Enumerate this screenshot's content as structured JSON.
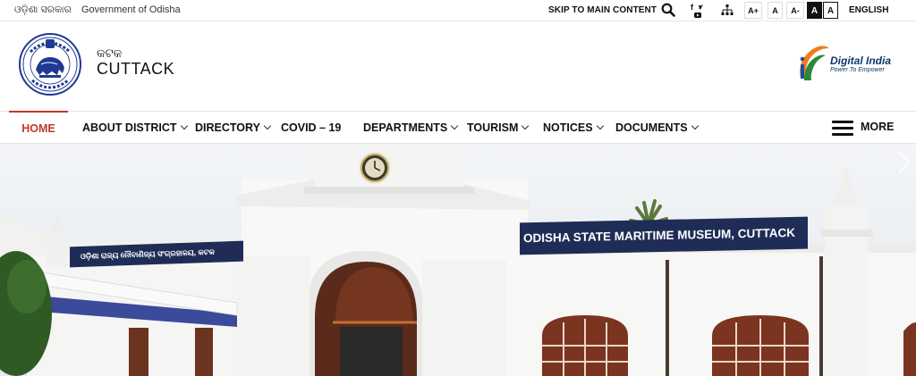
{
  "topbar": {
    "gov_odia": "ଓଡ଼ିଶା ସରକାର",
    "gov_en": "Government of Odisha",
    "skip_link": "SKIP TO MAIN CONTENT",
    "font_increase": "A+",
    "font_normal": "A",
    "font_decrease": "A-",
    "contrast_dark": "A",
    "contrast_light": "A",
    "language": "ENGLISH",
    "icons": [
      "search-icon",
      "facebook-icon",
      "twitter-icon",
      "youtube-icon",
      "sitemap-icon"
    ]
  },
  "header": {
    "district_odia": "କଟକ",
    "district_en": "CUTTACK",
    "digital_india_title": "Digital India",
    "digital_india_tagline": "Power To Empower",
    "emblem_text_top": "ଓଡ଼ିଶା ସରକାର",
    "emblem_text_bottom": "ସତ୍ୟମେବ ଜୟତେ"
  },
  "nav": {
    "items": [
      {
        "label": "HOME",
        "active": true,
        "dropdown": false
      },
      {
        "label": "ABOUT DISTRICT",
        "dropdown": true
      },
      {
        "label": "DIRECTORY",
        "dropdown": true
      },
      {
        "label": "COVID – 19",
        "dropdown": false
      },
      {
        "label": "DEPARTMENTS",
        "dropdown": true
      },
      {
        "label": "TOURISM",
        "dropdown": true
      },
      {
        "label": "NOTICES",
        "dropdown": true
      },
      {
        "label": "DOCUMENTS",
        "dropdown": true
      }
    ],
    "more_label": "MORE"
  },
  "hero": {
    "sign_main": "ODISHA STATE MARITIME MUSEUM, CUTTACK",
    "sign_odia": "ଓଡ଼ିଶା ରାଜ୍ୟ ନୌବାଣିଜ୍ୟ ସଂଗ୍ରହାଳୟ, କଟକ"
  },
  "colors": {
    "accent_active": "#c0392b",
    "sign_navy": "#1f2d56",
    "digital_india_blue": "#0c3a6a",
    "digital_india_orange": "#f07d1a"
  }
}
